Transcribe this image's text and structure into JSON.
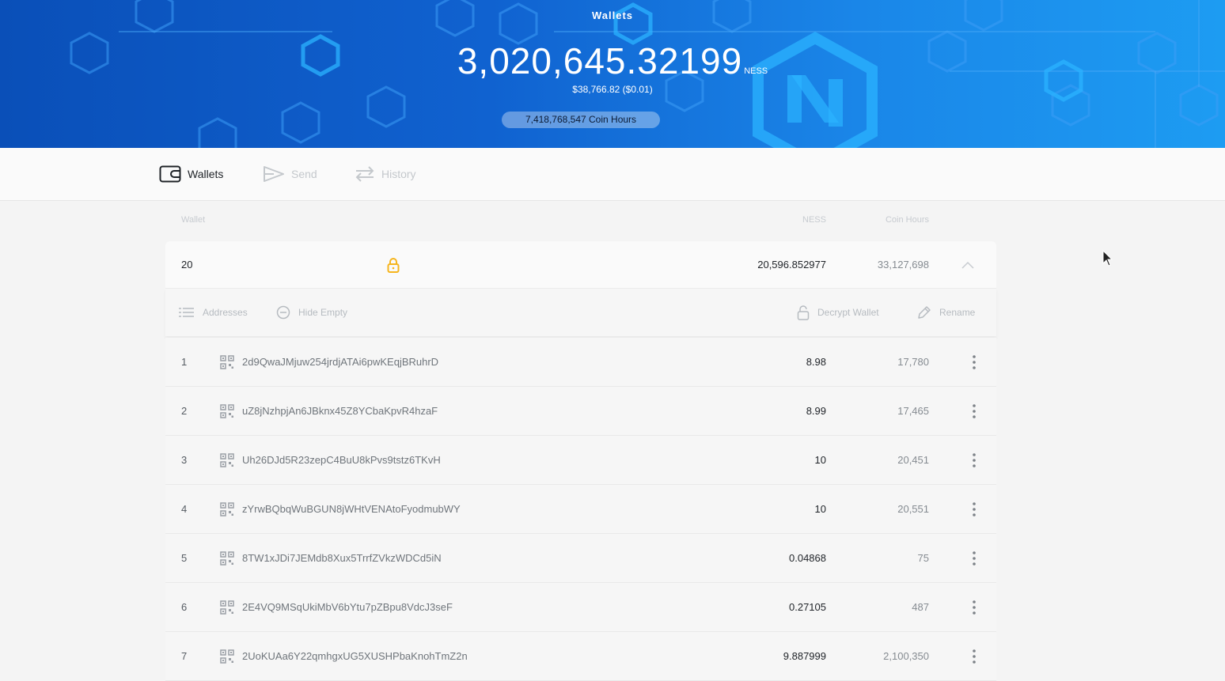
{
  "header": {
    "title": "Wallets",
    "balance": "3,020,645.32199",
    "unit": "NESS",
    "usd": "$38,766.82 ($0.01)",
    "coin_hours": "7,418,768,547 Coin Hours"
  },
  "nav": {
    "items": [
      {
        "label": "Wallets",
        "icon": "wallet-icon",
        "active": true
      },
      {
        "label": "Send",
        "icon": "send-icon",
        "active": false
      },
      {
        "label": "History",
        "icon": "history-icon",
        "active": false
      }
    ]
  },
  "table": {
    "columns": {
      "wallet": "Wallet",
      "coins": "NESS",
      "hours": "Coin Hours"
    },
    "wallet": {
      "name": "20",
      "coins": "20,596.852977",
      "hours": "33,127,698",
      "locked": true
    },
    "toolbar": {
      "addresses": "Addresses",
      "hide_empty": "Hide Empty",
      "decrypt": "Decrypt Wallet",
      "rename": "Rename"
    },
    "addresses": [
      {
        "index": "1",
        "address": "2d9QwaJMjuw254jrdjATAi6pwKEqjBRuhrD",
        "coins": "8.98",
        "hours": "17,780"
      },
      {
        "index": "2",
        "address": "uZ8jNzhpjAn6JBknx45Z8YCbaKpvR4hzaF",
        "coins": "8.99",
        "hours": "17,465"
      },
      {
        "index": "3",
        "address": "Uh26DJd5R23zepC4BuU8kPvs9tstz6TKvH",
        "coins": "10",
        "hours": "20,451"
      },
      {
        "index": "4",
        "address": "zYrwBQbqWuBGUN8jWHtVENAtoFyodmubWY",
        "coins": "10",
        "hours": "20,551"
      },
      {
        "index": "5",
        "address": "8TW1xJDi7JEMdb8Xux5TrrfZVkzWDCd5iN",
        "coins": "0.04868",
        "hours": "75"
      },
      {
        "index": "6",
        "address": "2E4VQ9MSqUkiMbV6bYtu7pZBpu8VdcJ3seF",
        "coins": "0.27105",
        "hours": "487"
      },
      {
        "index": "7",
        "address": "2UoKUAa6Y22qmhgxUG5XUSHPbaKnohTmZ2n",
        "coins": "9.887999",
        "hours": "2,100,350"
      }
    ]
  },
  "colors": {
    "header_start": "#0a4fb8",
    "header_end": "#1d9cf2",
    "lock": "#f6b51d"
  }
}
